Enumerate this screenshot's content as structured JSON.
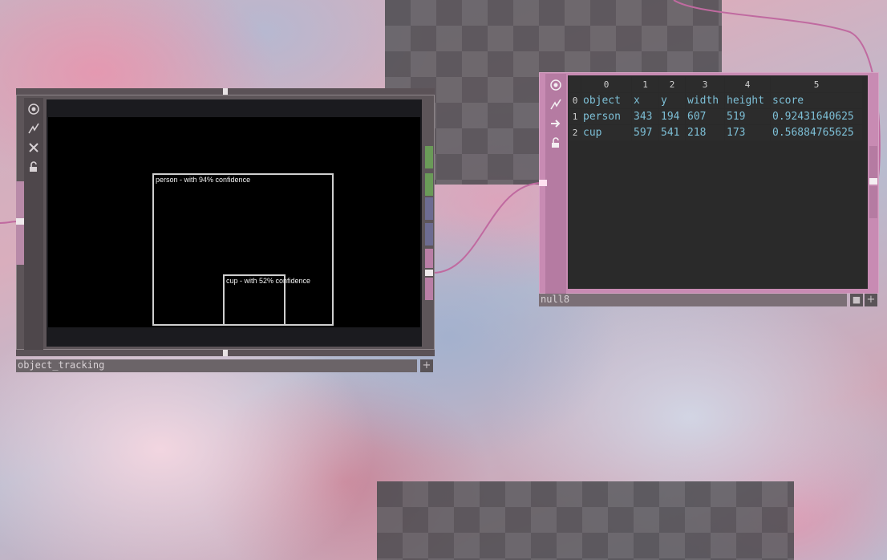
{
  "colors": {
    "top_family": "#8e8589",
    "dat_family": "#c88bb3",
    "wire": "#c06aa0",
    "cell_text": "#7dbfd6",
    "header_text": "#cfcfcf"
  },
  "nodes": {
    "object_tracking": {
      "name": "object_tracking",
      "rail_icons": [
        "viewer-icon",
        "bypass-icon",
        "close-icon",
        "lock-icon"
      ],
      "plus": "+",
      "detections": [
        {
          "label": "person - with 94% confidence"
        },
        {
          "label": "cup - with 52% confidence"
        }
      ]
    },
    "null8": {
      "name": "null8",
      "rail_icons": [
        "viewer-icon",
        "bypass-icon",
        "arrow-right-icon",
        "lock-icon"
      ],
      "plus": "+",
      "table": {
        "column_indices": [
          "0",
          "1",
          "2",
          "3",
          "4",
          "5"
        ],
        "row_indices": [
          "0",
          "1",
          "2"
        ],
        "rows": [
          [
            "object",
            "x",
            "y",
            "width",
            "height",
            "score"
          ],
          [
            "person",
            "343",
            "194",
            "607",
            "519",
            "0.92431640625"
          ],
          [
            "cup",
            "597",
            "541",
            "218",
            "173",
            "0.56884765625"
          ]
        ]
      }
    }
  }
}
